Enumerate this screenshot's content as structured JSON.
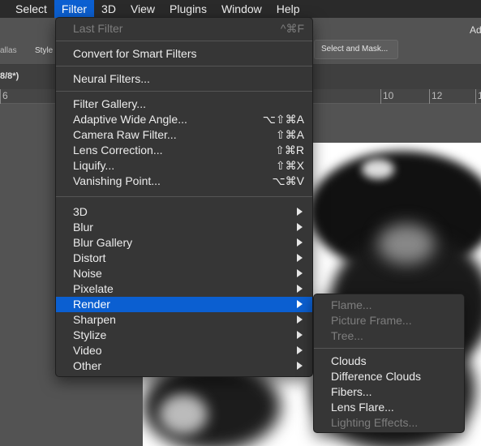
{
  "menubar": {
    "items": [
      "Select",
      "Filter",
      "3D",
      "View",
      "Plugins",
      "Window",
      "Help"
    ],
    "active": "Filter"
  },
  "options_bar": {
    "left_text_1": "allas",
    "left_text_2": "Style",
    "select_mask_button": "Select and Mask...",
    "right_edge_text": "Ad"
  },
  "doc_tab": {
    "label": "8/8*)"
  },
  "ruler": {
    "ticks": [
      "6",
      "10",
      "12",
      "1"
    ]
  },
  "filter_menu": {
    "last_filter": {
      "label": "Last Filter",
      "shortcut": "^⌘F"
    },
    "convert_smart": "Convert for Smart Filters",
    "neural_filters": "Neural Filters...",
    "group2": [
      {
        "label": "Filter Gallery...",
        "shortcut": ""
      },
      {
        "label": "Adaptive Wide Angle...",
        "shortcut": "⌥⇧⌘A"
      },
      {
        "label": "Camera Raw Filter...",
        "shortcut": "⇧⌘A"
      },
      {
        "label": "Lens Correction...",
        "shortcut": "⇧⌘R"
      },
      {
        "label": "Liquify...",
        "shortcut": "⇧⌘X"
      },
      {
        "label": "Vanishing Point...",
        "shortcut": "⌥⌘V"
      }
    ],
    "submenus": [
      "3D",
      "Blur",
      "Blur Gallery",
      "Distort",
      "Noise",
      "Pixelate",
      "Render",
      "Sharpen",
      "Stylize",
      "Video",
      "Other"
    ],
    "highlighted": "Render"
  },
  "render_submenu": {
    "disabled_items": [
      "Flame...",
      "Picture Frame...",
      "Tree..."
    ],
    "items": [
      "Clouds",
      "Difference Clouds",
      "Fibers...",
      "Lens Flare..."
    ],
    "last_disabled": "Lighting Effects..."
  },
  "colors": {
    "highlight": "#0b5fd1",
    "menu_bg": "#363636",
    "menubar_bg": "#2a2a2a"
  }
}
